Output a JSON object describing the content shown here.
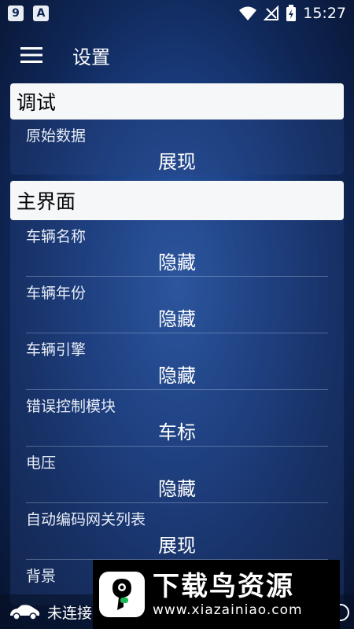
{
  "status_bar": {
    "app_badge_1": "9",
    "app_badge_2": "A",
    "time": "15:27"
  },
  "app_bar": {
    "title": "设置"
  },
  "sections": [
    {
      "header": "调试",
      "items": [
        {
          "label": "原始数据",
          "value": "展现"
        }
      ]
    },
    {
      "header": "主界面",
      "items": [
        {
          "label": "车辆名称",
          "value": "隐藏"
        },
        {
          "label": "车辆年份",
          "value": "隐藏"
        },
        {
          "label": "车辆引擎",
          "value": "隐藏"
        },
        {
          "label": "错误控制模块",
          "value": "车标"
        },
        {
          "label": "电压",
          "value": "隐藏"
        },
        {
          "label": "自动编码网关列表",
          "value": "展现"
        },
        {
          "label": "背景",
          "value": ""
        }
      ]
    }
  ],
  "bottom_bar": {
    "status_text": "未连接"
  },
  "watermark": {
    "title": "下载鸟资源",
    "url": "www.xiazainiao.com"
  }
}
